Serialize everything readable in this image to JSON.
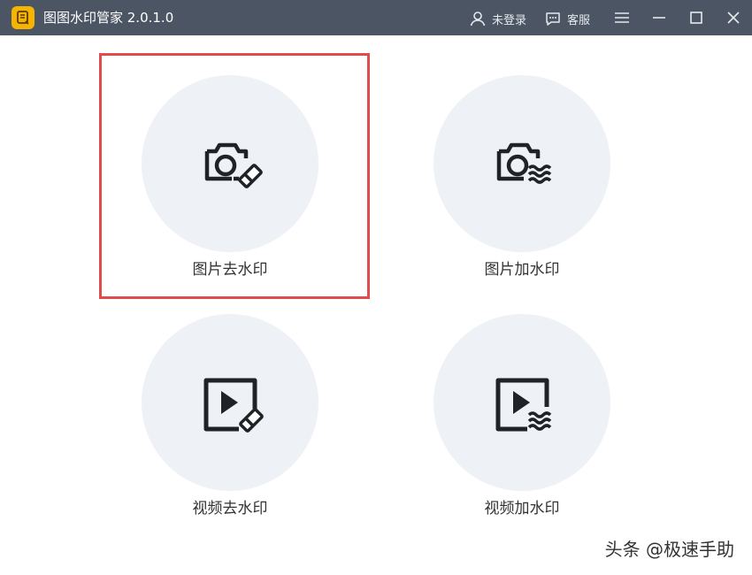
{
  "app": {
    "title": "图图水印管家  2.0.1.0"
  },
  "titlebar": {
    "login_label": "未登录",
    "service_label": "客服"
  },
  "tools": [
    {
      "label": "图片去水印",
      "icon": "camera-eraser-icon",
      "selected": true
    },
    {
      "label": "图片加水印",
      "icon": "camera-wave-icon",
      "selected": false
    },
    {
      "label": "视频去水印",
      "icon": "video-eraser-icon",
      "selected": false
    },
    {
      "label": "视频加水印",
      "icon": "video-wave-icon",
      "selected": false
    }
  ],
  "watermark_text": "头条 @极速手助",
  "colors": {
    "titlebar_bg": "#4b5563",
    "logo": "#f5b400",
    "card_bg": "#eef1f6",
    "highlight_border": "#e04b4b",
    "icon": "#1f2328"
  }
}
